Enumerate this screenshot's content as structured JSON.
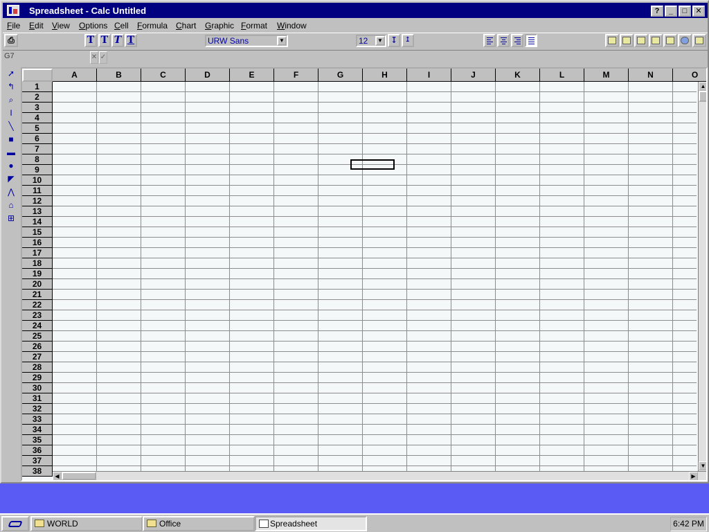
{
  "window": {
    "title": "Spreadsheet - Calc Untitled",
    "controls": {
      "help": "?",
      "minimize": "_",
      "maximize": "□",
      "close": "✕"
    }
  },
  "menu": [
    {
      "label": "File",
      "u": "F",
      "rest": "ile"
    },
    {
      "label": "Edit",
      "u": "E",
      "rest": "dit"
    },
    {
      "label": "View",
      "u": "V",
      "rest": "iew"
    },
    {
      "label": "Options",
      "u": "O",
      "rest": "ptions"
    },
    {
      "label": "Cell",
      "u": "C",
      "rest": "ell"
    },
    {
      "label": "Formula",
      "u": "F",
      "rest": "ormula"
    },
    {
      "label": "Chart",
      "u": "C",
      "rest": "hart"
    },
    {
      "label": "Graphic",
      "u": "G",
      "rest": "raphic"
    },
    {
      "label": "Format",
      "u": "F",
      "rest": "ormat"
    },
    {
      "label": "Window",
      "u": "W",
      "rest": "indow"
    }
  ],
  "toolbar": {
    "font_name": "URW Sans",
    "font_size": "12",
    "text_styles": [
      "T",
      "T",
      "T",
      "T"
    ]
  },
  "formula_bar": {
    "cell_ref": "G7",
    "cancel": "✕",
    "accept": "✓"
  },
  "sheet": {
    "columns": [
      "A",
      "B",
      "C",
      "D",
      "E",
      "F",
      "G",
      "H",
      "I",
      "J",
      "K",
      "L",
      "M",
      "N",
      "O"
    ],
    "rows": [
      "1",
      "2",
      "3",
      "4",
      "5",
      "6",
      "7",
      "8",
      "9",
      "10",
      "11",
      "12",
      "13",
      "14",
      "15",
      "16",
      "17",
      "18",
      "19",
      "20",
      "21",
      "22",
      "23",
      "24",
      "25",
      "26",
      "27",
      "28",
      "29",
      "30",
      "31",
      "32",
      "33",
      "34",
      "35",
      "36",
      "37",
      "38"
    ],
    "selected_cell": "G7"
  },
  "palette_icons": [
    "pointer-icon",
    "undo-arrow-icon",
    "zoom-icon",
    "text-cursor-icon",
    "line-icon",
    "rectangle-icon",
    "rounded-rectangle-icon",
    "ellipse-icon",
    "polygon-icon",
    "freehand-icon",
    "arc-icon",
    "group-icon"
  ],
  "taskbar": {
    "items": [
      {
        "label": "WORLD",
        "icon": "folder-icon"
      },
      {
        "label": "Office",
        "icon": "folder-icon"
      },
      {
        "label": "Spreadsheet",
        "icon": "spreadsheet-icon"
      }
    ],
    "clock": "6:42 PM"
  },
  "colors": {
    "title_bg": "#000080",
    "desktop": "#5a5af5",
    "chrome": "#c0c0c0"
  }
}
